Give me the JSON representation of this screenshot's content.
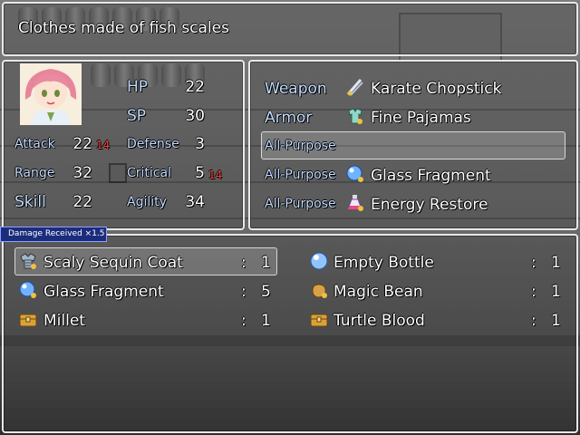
{
  "help": {
    "text": "Clothes made of fish scales"
  },
  "status": {
    "hp_label": "HP",
    "hp": "22",
    "sp_label": "SP",
    "sp": "30",
    "attack_label": "Attack",
    "attack": "22",
    "attack_bonus": "14",
    "defense_label": "Defense",
    "defense": "3",
    "range_label": "Range",
    "range": "32",
    "critical_label": "Critical",
    "critical": "5",
    "critical_bonus": "14",
    "skill_label": "Skill",
    "skill": "22",
    "agility_label": "Agility",
    "agility": "34"
  },
  "equipment": [
    {
      "slot": "Weapon",
      "item": "Karate Chopstick",
      "icon": "chopstick-icon"
    },
    {
      "slot": "Armor",
      "item": "Fine Pajamas",
      "icon": "pajamas-icon"
    },
    {
      "slot": "All-Purpose",
      "item": "",
      "icon": ""
    },
    {
      "slot": "All-Purpose",
      "item": "Glass Fragment",
      "icon": "glass-orb-icon"
    },
    {
      "slot": "All-Purpose",
      "item": "Energy Restore",
      "icon": "potion-icon"
    }
  ],
  "damage_tag": "Damage Received ×1.5",
  "items": [
    {
      "name": "Scaly Sequin Coat",
      "colon": ":",
      "count": "1",
      "icon": "coat-icon"
    },
    {
      "name": "Empty Bottle",
      "colon": ":",
      "count": "1",
      "icon": "bubble-icon"
    },
    {
      "name": "Glass Fragment",
      "colon": ":",
      "count": "5",
      "icon": "glass-orb-icon"
    },
    {
      "name": "Magic Bean",
      "colon": ":",
      "count": "1",
      "icon": "bean-bag-icon"
    },
    {
      "name": "Millet",
      "colon": ":",
      "count": "1",
      "icon": "chest-icon"
    },
    {
      "name": "Turtle Blood",
      "colon": ":",
      "count": "1",
      "icon": "chest-icon"
    }
  ]
}
